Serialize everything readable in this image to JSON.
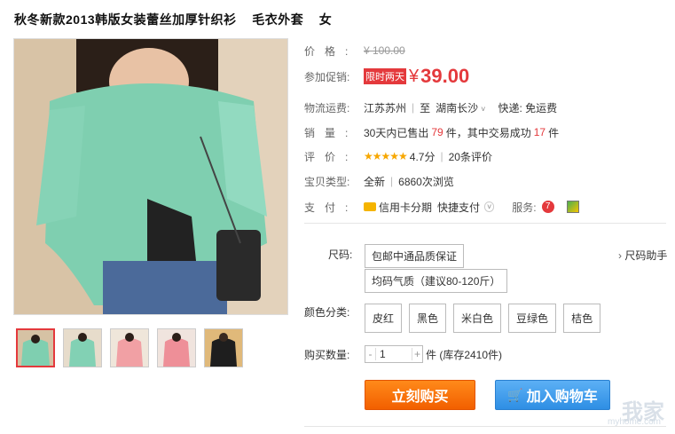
{
  "product": {
    "title": "秋冬新款2013韩版女装蕾丝加厚针织衫    毛衣外套    女"
  },
  "labels": {
    "price": "价格:",
    "promo_price": "参加促销:",
    "shipping": "物流运费:",
    "sales": "销量:",
    "rating": "评价:",
    "type": "宝贝类型:",
    "payment": "支付:",
    "size": "尺码:",
    "color": "颜色分类:",
    "quantity": "购买数量:"
  },
  "price": {
    "original": "¥ 100.00",
    "promo_tag": "限时两天",
    "yen": "¥",
    "current": "39.00"
  },
  "shipping": {
    "from": "江苏苏州",
    "to_sep": "至",
    "to": "湖南长沙",
    "express": "快递: 免运费"
  },
  "sales": {
    "prefix": "30天内已售出",
    "sold": "79",
    "mid": "件，其中交易成功",
    "success": "17",
    "suffix": "件"
  },
  "rating": {
    "stars": "★★★★★",
    "score": "4.7分",
    "reviews": "20条评价"
  },
  "type": {
    "condition": "全新",
    "views": "6860次浏览"
  },
  "payment": {
    "credit": "信用卡分期",
    "quick": "快捷支付",
    "service_label": "服务:"
  },
  "size": {
    "options": [
      "包邮中通品质保证",
      "均码气质（建议80-120斤）"
    ],
    "help": "尺码助手"
  },
  "colors": {
    "options": [
      "皮红",
      "黑色",
      "米白色",
      "豆绿色",
      "桔色"
    ]
  },
  "quantity": {
    "minus": "-",
    "value": "1",
    "plus": "+",
    "stock": "件 (库存2410件)"
  },
  "buttons": {
    "buy": "立刻购买",
    "cart": "加入购物车"
  },
  "watermark": {
    "main": "我家",
    "sub": "myhome.com"
  },
  "theme": {
    "accent": "#e4393c",
    "buy": "#f25f00",
    "cart": "#2e8ee4",
    "star": "#f7a700"
  }
}
